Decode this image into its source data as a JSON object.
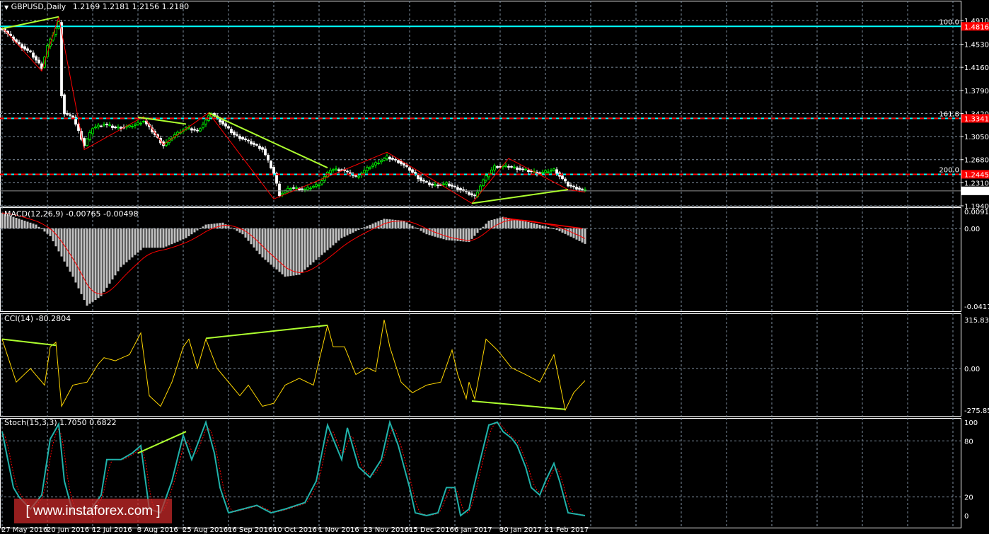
{
  "header": {
    "symbol": "GBPUSD,Daily",
    "ohlc": "1.2169 1.2181 1.2156 1.2180"
  },
  "colors": {
    "bull": "#00ff00",
    "bear": "#ffffff",
    "cyan": "#00ffff",
    "red": "#ff0000",
    "trend": "#adff2f",
    "cci": "#ffd700",
    "stoch": "#20b2aa",
    "grid": "#8090a0"
  },
  "price_axis": {
    "ticks": [
      "1.4910",
      "1.4530",
      "1.4160",
      "1.3790",
      "1.3420",
      "1.3050",
      "1.2680",
      "1.2310",
      "1.1940"
    ],
    "current": "1.2180"
  },
  "levels": [
    {
      "label": "100.0",
      "price": 1.4816,
      "tag": "1.4816"
    },
    {
      "label": "161.8",
      "price": 1.3341,
      "tag": "1.3341"
    },
    {
      "label": "200.0",
      "price": 1.2445,
      "tag": "1.2445"
    }
  ],
  "macd": {
    "title": "MACD(12,26,9) -0.00765 -0.00498",
    "ticks": [
      "0.00919",
      "0.00",
      "-0.04175"
    ]
  },
  "cci": {
    "title": "CCI(14) -80.2804",
    "ticks": [
      "315.8312",
      "0.00",
      "-275.855"
    ]
  },
  "stoch": {
    "title": "Stoch(15,3,3) 1.7050 0.6822",
    "ticks": [
      "100",
      "80",
      "20",
      "0"
    ]
  },
  "dates": [
    "27 May 2016",
    "20 Jun 2016",
    "12 Jul 2016",
    "3 Aug 2016",
    "25 Aug 2016",
    "16 Sep 2016",
    "10 Oct 2016",
    "1 Nov 2016",
    "23 Nov 2016",
    "15 Dec 2016",
    "6 Jan 2017",
    "30 Jan 2017",
    "21 Feb 2017"
  ],
  "watermark": "[ www.instaforex.com ]",
  "chart_data": {
    "type": "line",
    "bars": 207,
    "price": [
      [
        0,
        1.478
      ],
      [
        5,
        1.456
      ],
      [
        10,
        1.439
      ],
      [
        14,
        1.416
      ],
      [
        16,
        1.45
      ],
      [
        20,
        1.488
      ],
      [
        21,
        1.372
      ],
      [
        22,
        1.342
      ],
      [
        25,
        1.336
      ],
      [
        29,
        1.291
      ],
      [
        32,
        1.319
      ],
      [
        36,
        1.325
      ],
      [
        40,
        1.319
      ],
      [
        45,
        1.321
      ],
      [
        50,
        1.33
      ],
      [
        54,
        1.308
      ],
      [
        57,
        1.291
      ],
      [
        61,
        1.308
      ],
      [
        65,
        1.319
      ],
      [
        69,
        1.314
      ],
      [
        74,
        1.342
      ],
      [
        77,
        1.33
      ],
      [
        82,
        1.308
      ],
      [
        87,
        1.297
      ],
      [
        92,
        1.285
      ],
      [
        96,
        1.246
      ],
      [
        98,
        1.212
      ],
      [
        102,
        1.223
      ],
      [
        107,
        1.22
      ],
      [
        112,
        1.229
      ],
      [
        116,
        1.252
      ],
      [
        120,
        1.252
      ],
      [
        125,
        1.24
      ],
      [
        130,
        1.257
      ],
      [
        136,
        1.272
      ],
      [
        140,
        1.265
      ],
      [
        144,
        1.252
      ],
      [
        148,
        1.235
      ],
      [
        152,
        1.227
      ],
      [
        157,
        1.229
      ],
      [
        162,
        1.22
      ],
      [
        167,
        1.209
      ],
      [
        170,
        1.235
      ],
      [
        174,
        1.257
      ],
      [
        179,
        1.257
      ],
      [
        184,
        1.252
      ],
      [
        190,
        1.246
      ],
      [
        195,
        1.252
      ],
      [
        200,
        1.227
      ],
      [
        206,
        1.218
      ]
    ],
    "macd": [
      [
        0,
        0.008
      ],
      [
        12,
        0.002
      ],
      [
        17,
        -0.004
      ],
      [
        25,
        -0.025
      ],
      [
        30,
        -0.04
      ],
      [
        35,
        -0.035
      ],
      [
        42,
        -0.02
      ],
      [
        50,
        -0.01
      ],
      [
        57,
        -0.01
      ],
      [
        65,
        -0.005
      ],
      [
        72,
        0.002
      ],
      [
        78,
        0.003
      ],
      [
        85,
        -0.003
      ],
      [
        92,
        -0.015
      ],
      [
        100,
        -0.025
      ],
      [
        105,
        -0.024
      ],
      [
        112,
        -0.015
      ],
      [
        120,
        -0.005
      ],
      [
        127,
        0
      ],
      [
        135,
        0.005
      ],
      [
        142,
        0.004
      ],
      [
        150,
        -0.003
      ],
      [
        157,
        -0.006
      ],
      [
        165,
        -0.007
      ],
      [
        172,
        0.004
      ],
      [
        177,
        0.006
      ],
      [
        187,
        0.003
      ],
      [
        195,
        0
      ],
      [
        202,
        -0.005
      ],
      [
        206,
        -0.008
      ]
    ],
    "cci": [
      [
        0,
        190
      ],
      [
        5,
        -90
      ],
      [
        10,
        0
      ],
      [
        15,
        -110
      ],
      [
        17,
        140
      ],
      [
        19,
        170
      ],
      [
        21,
        -250
      ],
      [
        25,
        -110
      ],
      [
        30,
        -90
      ],
      [
        34,
        30
      ],
      [
        36,
        70
      ],
      [
        40,
        50
      ],
      [
        45,
        90
      ],
      [
        49,
        230
      ],
      [
        52,
        -180
      ],
      [
        56,
        -250
      ],
      [
        60,
        -90
      ],
      [
        64,
        140
      ],
      [
        66,
        190
      ],
      [
        69,
        0
      ],
      [
        72,
        190
      ],
      [
        76,
        0
      ],
      [
        80,
        -90
      ],
      [
        84,
        -180
      ],
      [
        87,
        -110
      ],
      [
        92,
        -250
      ],
      [
        96,
        -230
      ],
      [
        100,
        -110
      ],
      [
        105,
        -65
      ],
      [
        110,
        -110
      ],
      [
        112,
        50
      ],
      [
        115,
        280
      ],
      [
        117,
        140
      ],
      [
        121,
        140
      ],
      [
        125,
        -40
      ],
      [
        129,
        5
      ],
      [
        132,
        -20
      ],
      [
        135,
        315
      ],
      [
        137,
        140
      ],
      [
        141,
        -90
      ],
      [
        145,
        -160
      ],
      [
        150,
        -110
      ],
      [
        155,
        -90
      ],
      [
        159,
        120
      ],
      [
        161,
        -40
      ],
      [
        164,
        -200
      ],
      [
        165,
        -90
      ],
      [
        167,
        -200
      ],
      [
        171,
        190
      ],
      [
        175,
        120
      ],
      [
        180,
        5
      ],
      [
        185,
        -40
      ],
      [
        190,
        -90
      ],
      [
        195,
        90
      ],
      [
        199,
        -275
      ],
      [
        202,
        -160
      ],
      [
        206,
        -80
      ]
    ],
    "stoch": [
      [
        0,
        90
      ],
      [
        4,
        30
      ],
      [
        6,
        20
      ],
      [
        10,
        7
      ],
      [
        14,
        22
      ],
      [
        17,
        82
      ],
      [
        20,
        98
      ],
      [
        22,
        37
      ],
      [
        25,
        3
      ],
      [
        30,
        1
      ],
      [
        35,
        22
      ],
      [
        37,
        60
      ],
      [
        42,
        60
      ],
      [
        46,
        67
      ],
      [
        49,
        75
      ],
      [
        52,
        7
      ],
      [
        56,
        3
      ],
      [
        60,
        37
      ],
      [
        64,
        86
      ],
      [
        67,
        60
      ],
      [
        72,
        100
      ],
      [
        75,
        67
      ],
      [
        77,
        30
      ],
      [
        80,
        3
      ],
      [
        85,
        7
      ],
      [
        90,
        11
      ],
      [
        95,
        3
      ],
      [
        100,
        7
      ],
      [
        107,
        14
      ],
      [
        111,
        37
      ],
      [
        115,
        97
      ],
      [
        117,
        82
      ],
      [
        120,
        60
      ],
      [
        122,
        94
      ],
      [
        126,
        52
      ],
      [
        130,
        41
      ],
      [
        134,
        60
      ],
      [
        137,
        100
      ],
      [
        140,
        75
      ],
      [
        144,
        30
      ],
      [
        146,
        3
      ],
      [
        150,
        0
      ],
      [
        154,
        3
      ],
      [
        157,
        30
      ],
      [
        160,
        30
      ],
      [
        162,
        0
      ],
      [
        165,
        7
      ],
      [
        166,
        22
      ],
      [
        169,
        60
      ],
      [
        172,
        97
      ],
      [
        175,
        100
      ],
      [
        177,
        90
      ],
      [
        180,
        83
      ],
      [
        182,
        75
      ],
      [
        185,
        52
      ],
      [
        187,
        30
      ],
      [
        190,
        22
      ],
      [
        192,
        37
      ],
      [
        195,
        56
      ],
      [
        197,
        37
      ],
      [
        200,
        3
      ],
      [
        204,
        1
      ],
      [
        206,
        0
      ]
    ],
    "trendlines_price": [
      [
        [
          0,
          1.478
        ],
        [
          20,
          1.497
        ]
      ],
      [
        [
          48,
          1.336
        ],
        [
          65,
          1.325
        ]
      ],
      [
        [
          73,
          1.343
        ],
        [
          115,
          1.255
        ]
      ],
      [
        [
          166,
          1.198
        ],
        [
          200,
          1.22
        ]
      ]
    ],
    "zigzag_price": [
      [
        0,
        1.48
      ],
      [
        14,
        1.41
      ],
      [
        20,
        1.497
      ],
      [
        29,
        1.284
      ],
      [
        50,
        1.337
      ],
      [
        57,
        1.292
      ],
      [
        73,
        1.343
      ],
      [
        96,
        1.205
      ],
      [
        136,
        1.28
      ],
      [
        166,
        1.198
      ],
      [
        179,
        1.27
      ],
      [
        200,
        1.22
      ],
      [
        206,
        1.216
      ]
    ],
    "macd_trendline": [
      [
        177,
        0.0055
      ],
      [
        205,
        0
      ]
    ],
    "cci_trendlines": [
      [
        [
          0,
          190
        ],
        [
          19,
          150
        ]
      ],
      [
        [
          72,
          195
        ],
        [
          115,
          280
        ]
      ],
      [
        [
          166,
          -215
        ],
        [
          199,
          -270
        ]
      ]
    ],
    "stoch_trendline": [
      [
        48,
        67
      ],
      [
        65,
        90
      ]
    ]
  }
}
